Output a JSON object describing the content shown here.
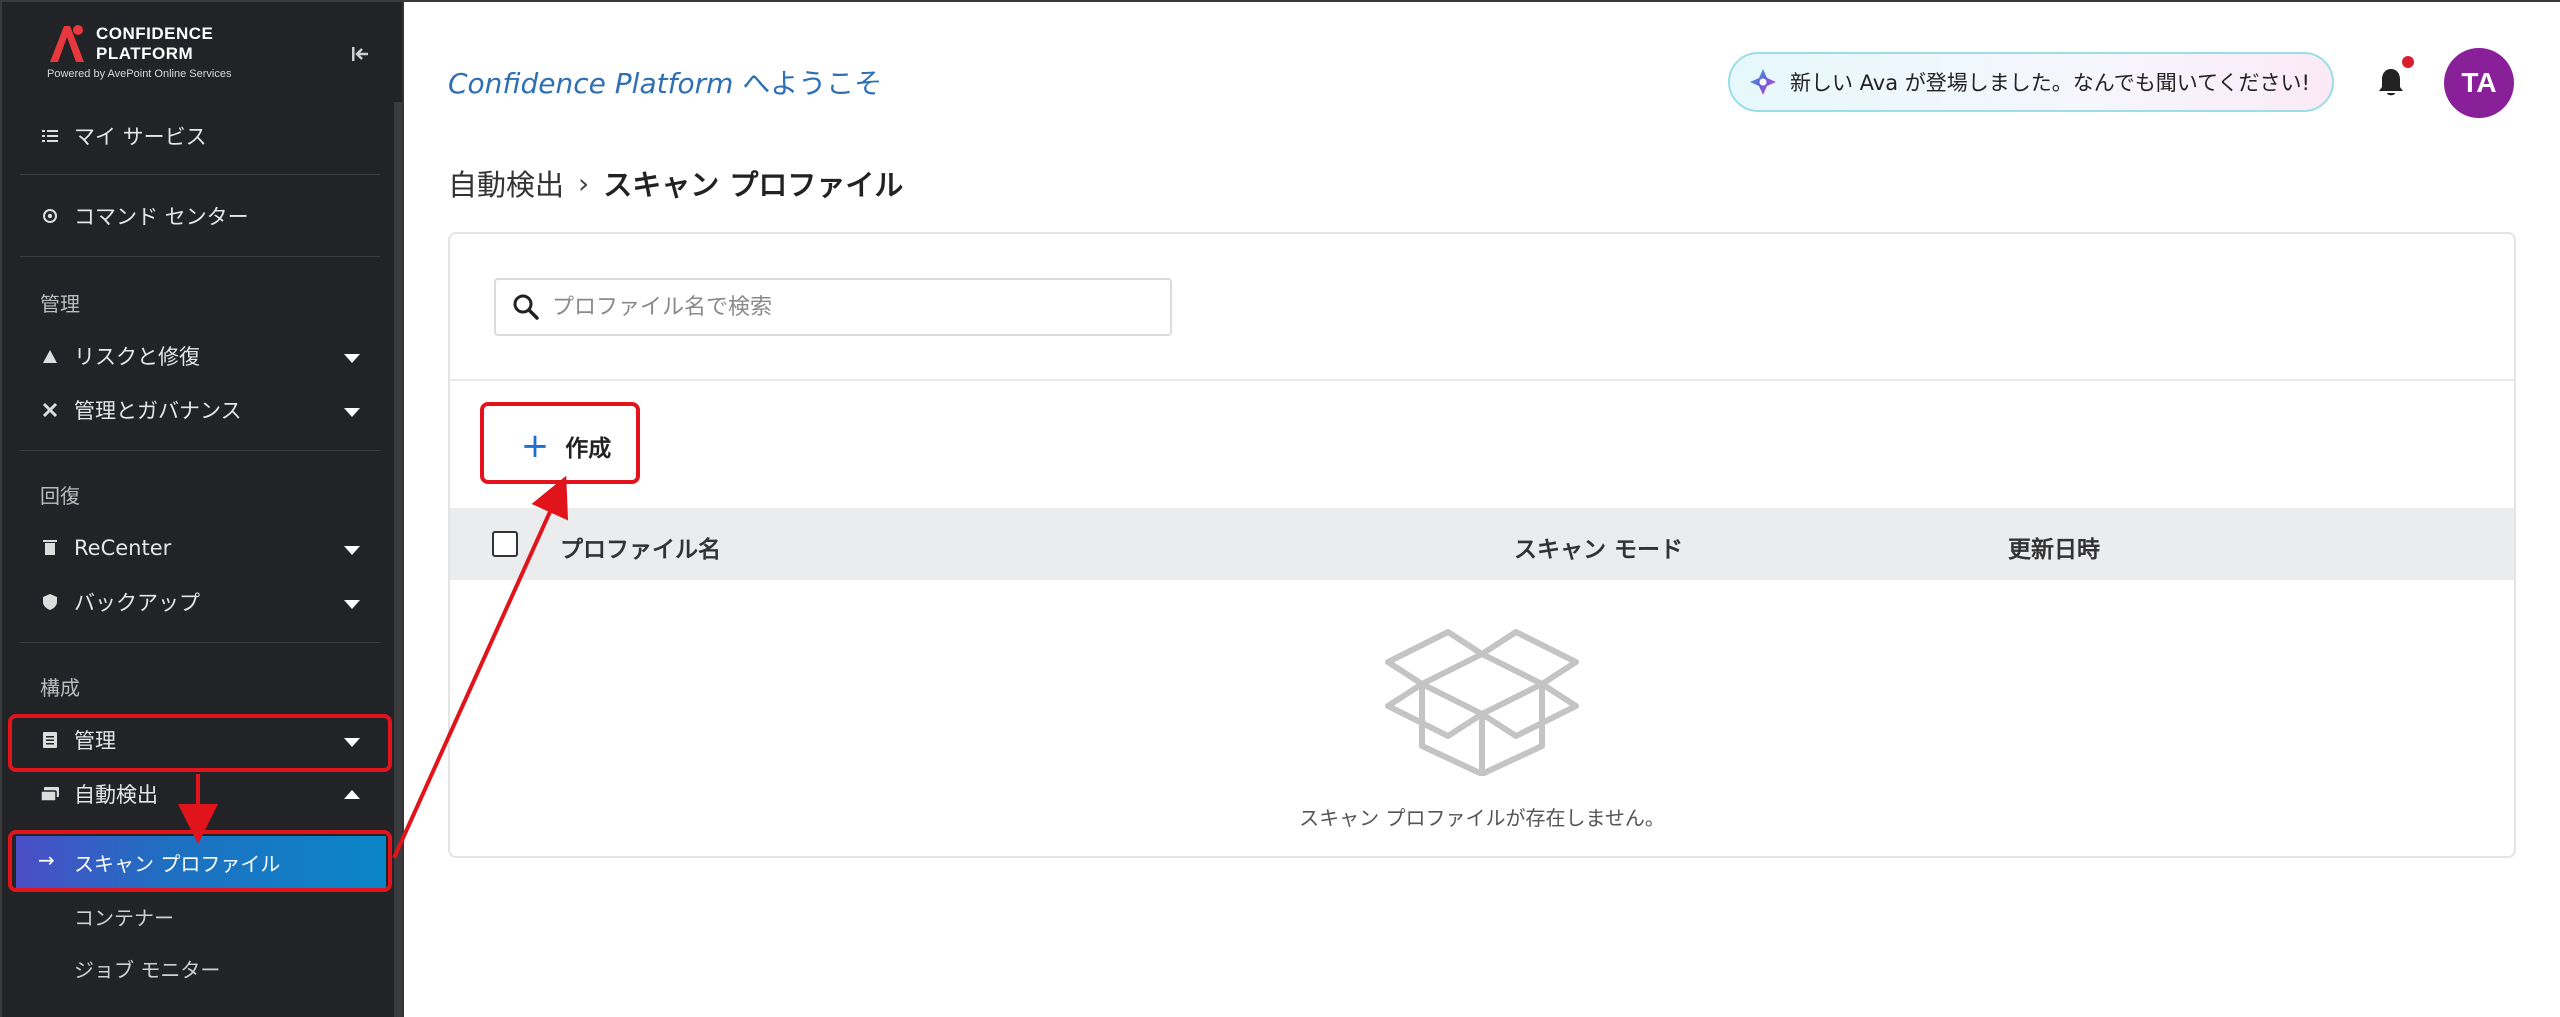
{
  "app": {
    "logo_line1": "CONFIDENCE",
    "logo_line2": "PLATFORM",
    "logo_sub": "Powered by AvePoint Online Services"
  },
  "sidebar": {
    "items": [
      {
        "label": "マイ サービス",
        "icon": "list-icon"
      },
      {
        "label": "コマンド センター",
        "icon": "target-icon"
      }
    ],
    "sections": [
      {
        "title": "管理",
        "items": [
          {
            "label": "リスクと修復",
            "icon": "warning-icon"
          },
          {
            "label": "管理とガバナンス",
            "icon": "tools-icon"
          }
        ]
      },
      {
        "title": "回復",
        "items": [
          {
            "label": "ReCenter",
            "icon": "trash-icon"
          },
          {
            "label": "バックアップ",
            "icon": "shield-icon"
          }
        ]
      },
      {
        "title": "構成",
        "items": [
          {
            "label": "管理",
            "icon": "document-icon"
          },
          {
            "label": "自動検出",
            "icon": "discovery-icon"
          }
        ]
      }
    ],
    "sub_items": [
      {
        "label": "スキャン プロファイル",
        "active": true
      },
      {
        "label": "コンテナー"
      },
      {
        "label": "ジョブ モニター"
      }
    ]
  },
  "header": {
    "welcome_brand": "Confidence Platform",
    "welcome_suffix": " へようこそ",
    "ava_banner": "新しい Ava が登場しました。なんでも聞いてください!",
    "avatar_initials": "TA",
    "notification_unread": true
  },
  "breadcrumb": {
    "parent": "自動検出",
    "separator": "›",
    "current": "スキャン プロファイル"
  },
  "search": {
    "placeholder": "プロファイル名で検索",
    "value": ""
  },
  "toolbar": {
    "create_label": "作成",
    "create_icon": "+"
  },
  "table": {
    "columns": [
      "プロファイル名",
      "スキャン モード",
      "更新日時"
    ],
    "rows": [],
    "empty_message": "スキャン プロファイルが存在しません。"
  },
  "colors": {
    "sidebar_bg": "#222326",
    "accent": "#1e6fd1",
    "active_gradient_start": "#4a4ec7",
    "active_gradient_end": "#0a86c7",
    "annotation_red": "#e0141a",
    "avatar_bg": "#8a1f9a"
  }
}
